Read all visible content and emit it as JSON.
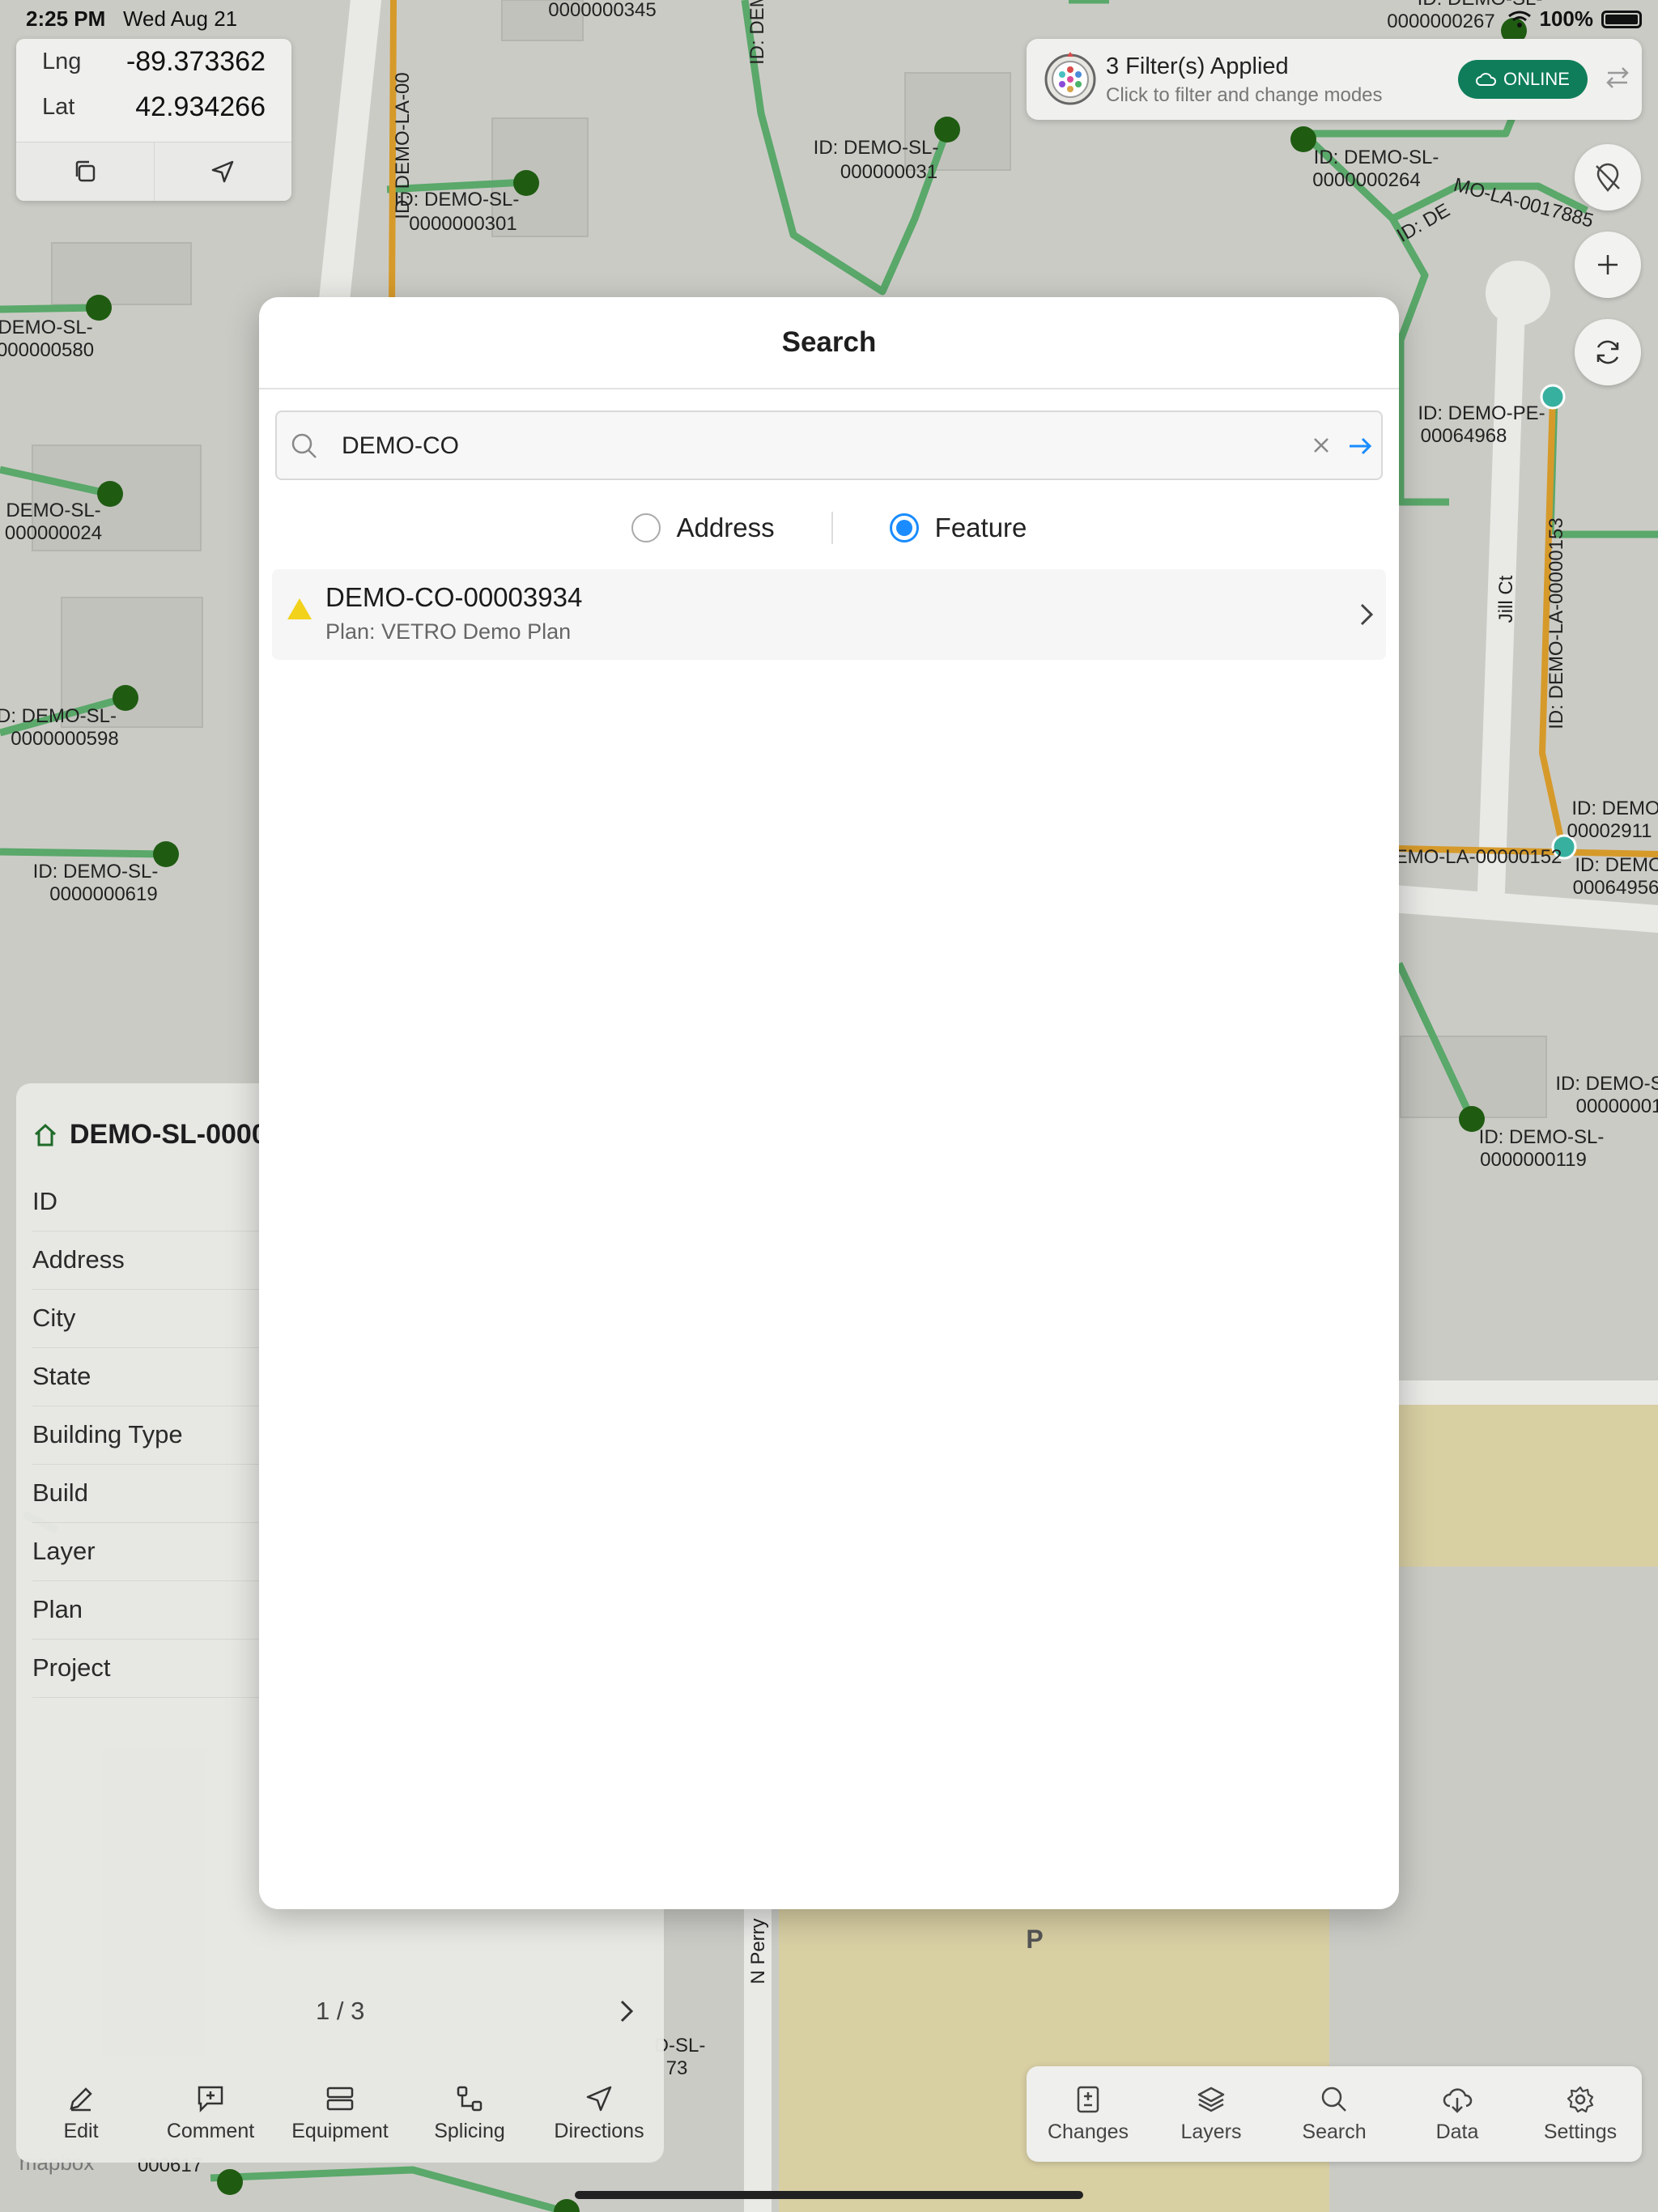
{
  "status_bar": {
    "time": "2:25 PM",
    "date": "Wed Aug 21",
    "battery": "100%"
  },
  "coords": {
    "lng_label": "Lng",
    "lng_value": "-89.373362",
    "lat_label": "Lat",
    "lat_value": "42.934266"
  },
  "filter_bar": {
    "title": "3 Filter(s) Applied",
    "subtitle": "Click to filter and change modes",
    "status": "ONLINE"
  },
  "map_labels": [
    "0000000345",
    "ID: DEMO-LA-00",
    "ID: DEMO",
    "ID: DEMO-SL-",
    "0000000267",
    "ID: DEMO-SL-",
    "000000031",
    "ID: DEMO-SL-",
    "0000000301",
    "ID: DEMO-SL-",
    "0000000264",
    "ID: DE",
    "MO-LA-0017885",
    "DEMO-SL-",
    "000000580",
    "ID: DEMO-PE-",
    "00064968",
    "DEMO-SL-",
    "000000024",
    "ID: DEMO-LA-00000153",
    "Jill Ct",
    "D: DEMO-SL-",
    "0000000598",
    "ID: DEMO-",
    "00002911",
    "ID: DEMO-SL-",
    "0000000619",
    "EMO-LA-00000152",
    "ID: DEMO",
    "00064956",
    "ID: DEMO-S",
    "00000001",
    "ID: DEMO-SL-",
    "0000000119",
    "N Perry",
    "P",
    "D-SL-",
    "73",
    "mapbox",
    "000617"
  ],
  "detail_panel": {
    "title": "DEMO-SL-0000",
    "fields": [
      "ID",
      "Address",
      "City",
      "State",
      "Building Type",
      "Build",
      "Layer",
      "Plan",
      "Project"
    ],
    "pager": "1 / 3",
    "actions": [
      "Edit",
      "Comment",
      "Equipment",
      "Splicing",
      "Directions"
    ]
  },
  "tab_bar": {
    "tabs": [
      "Changes",
      "Layers",
      "Search",
      "Data",
      "Settings"
    ]
  },
  "modal": {
    "title": "Search",
    "search_value": "DEMO-CO",
    "modes": {
      "address": "Address",
      "feature": "Feature",
      "selected": "Feature"
    },
    "results": [
      {
        "title": "DEMO-CO-00003934",
        "subtitle": "Plan: VETRO Demo Plan"
      }
    ]
  },
  "colors": {
    "accent": "#1a8cff",
    "online": "#0f7d5a",
    "feature_line": "#5aa86a",
    "lateral_line": "#d69a2a",
    "node": "#1f5c12",
    "warn": "#f2d21b"
  }
}
